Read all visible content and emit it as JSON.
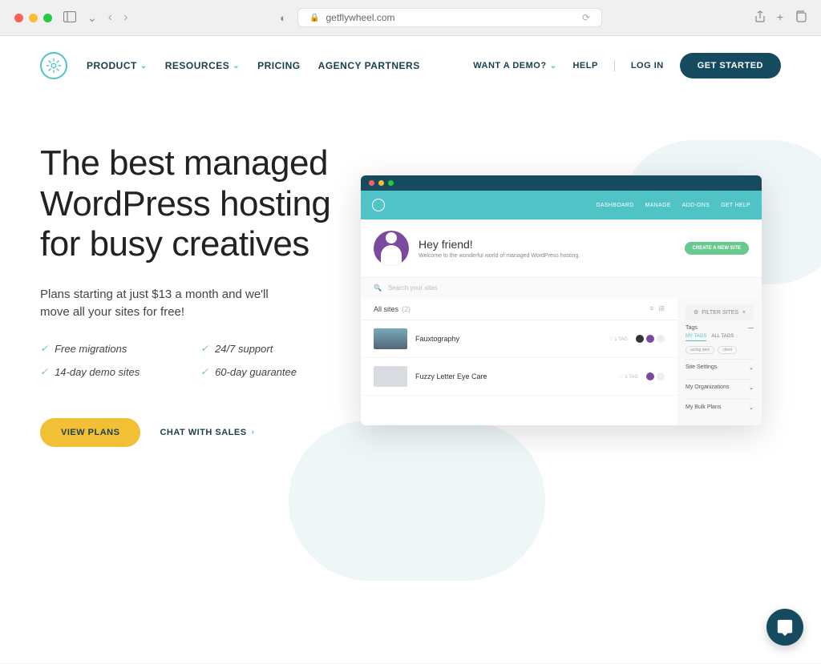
{
  "browser": {
    "url": "getflywheel.com"
  },
  "nav": {
    "items": [
      "PRODUCT",
      "RESOURCES",
      "PRICING",
      "AGENCY PARTNERS"
    ],
    "right": {
      "demo": "WANT A DEMO?",
      "help": "HELP",
      "login": "LOG IN",
      "cta": "GET STARTED"
    }
  },
  "hero": {
    "title": "The best managed WordPress hosting for busy creatives",
    "subtitle": "Plans starting at just $13 a month and we'll move all your sites for free!",
    "features": [
      "Free migrations",
      "24/7 support",
      "14-day demo sites",
      "60-day guarantee"
    ],
    "cta_primary": "VIEW PLANS",
    "cta_secondary": "CHAT WITH SALES"
  },
  "dashboard": {
    "nav_items": [
      "DASHBOARD",
      "MANAGE",
      "ADD-ONS",
      "GET HELP"
    ],
    "greeting": "Hey friend!",
    "welcome": "Welcome to the wonderful world of managed WordPress hosting.",
    "create_btn": "CREATE A NEW SITE",
    "search_placeholder": "Search your sites",
    "filter_label": "FILTER SITES",
    "all_sites_label": "All sites",
    "all_sites_count": "(2)",
    "sites": [
      {
        "name": "Fauxtography",
        "tag": "1 TAG"
      },
      {
        "name": "Fuzzy Letter Eye Care",
        "tag": "1 TAG"
      }
    ],
    "sidebar": {
      "tags_title": "Tags",
      "tag_tabs": [
        "MY TAGS",
        "ALL TAGS"
      ],
      "chips": [
        "acting dem",
        "client"
      ],
      "settings": "Site Settings",
      "orgs": "My Organizations",
      "bulk": "My Bulk Plans"
    }
  }
}
